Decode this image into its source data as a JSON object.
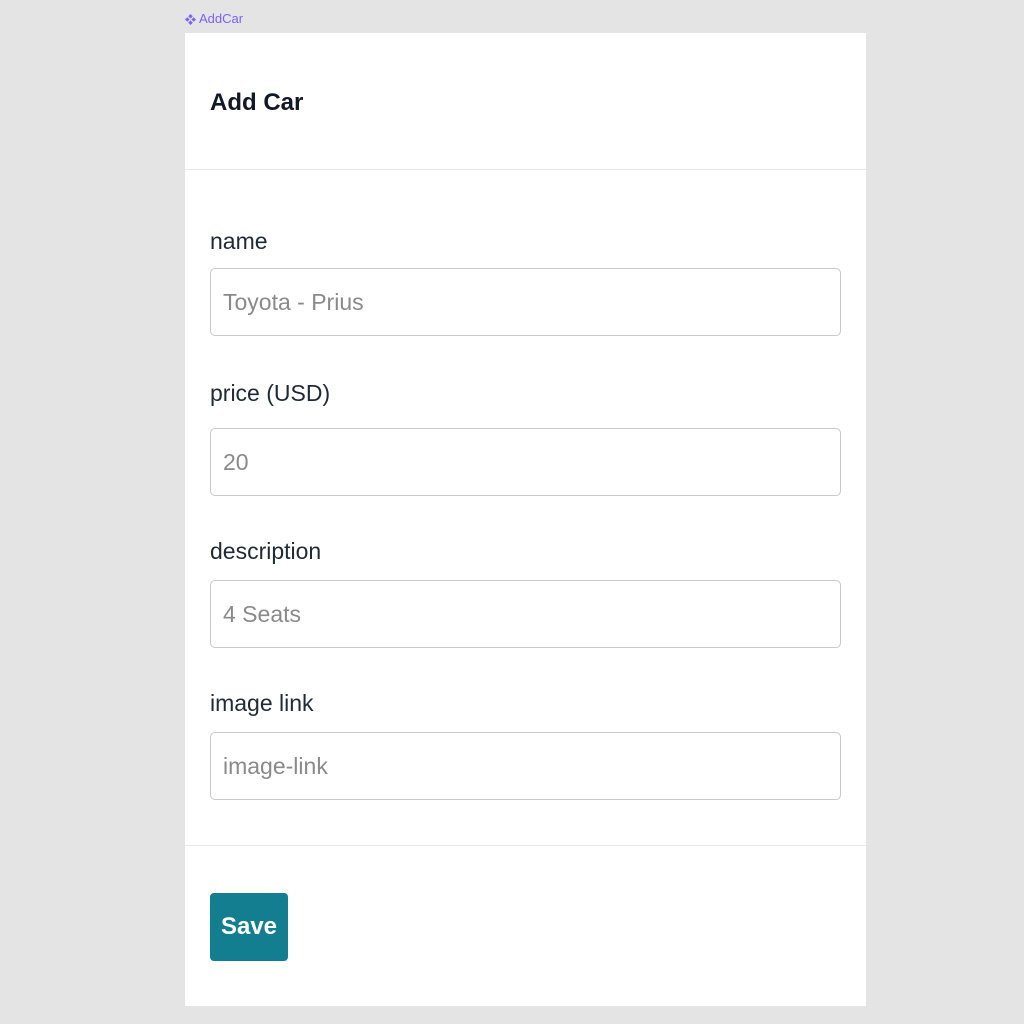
{
  "component_tag": {
    "icon": "component-diamond-icon",
    "label": "AddCar",
    "color": "#7b61ff"
  },
  "header": {
    "title": "Add Car"
  },
  "form": {
    "fields": [
      {
        "label": "name",
        "placeholder": "Toyota - Prius",
        "value": ""
      },
      {
        "label": "price (USD)",
        "placeholder": "20",
        "value": ""
      },
      {
        "label": "description",
        "placeholder": "4 Seats",
        "value": ""
      },
      {
        "label": "image link",
        "placeholder": "image-link",
        "value": ""
      }
    ]
  },
  "footer": {
    "save_label": "Save"
  },
  "colors": {
    "background": "#e4e4e4",
    "card": "#ffffff",
    "accent": "#127e8f",
    "title_text": "#111827",
    "placeholder_text": "#8a8a8a",
    "input_border": "#c9c9c9"
  }
}
